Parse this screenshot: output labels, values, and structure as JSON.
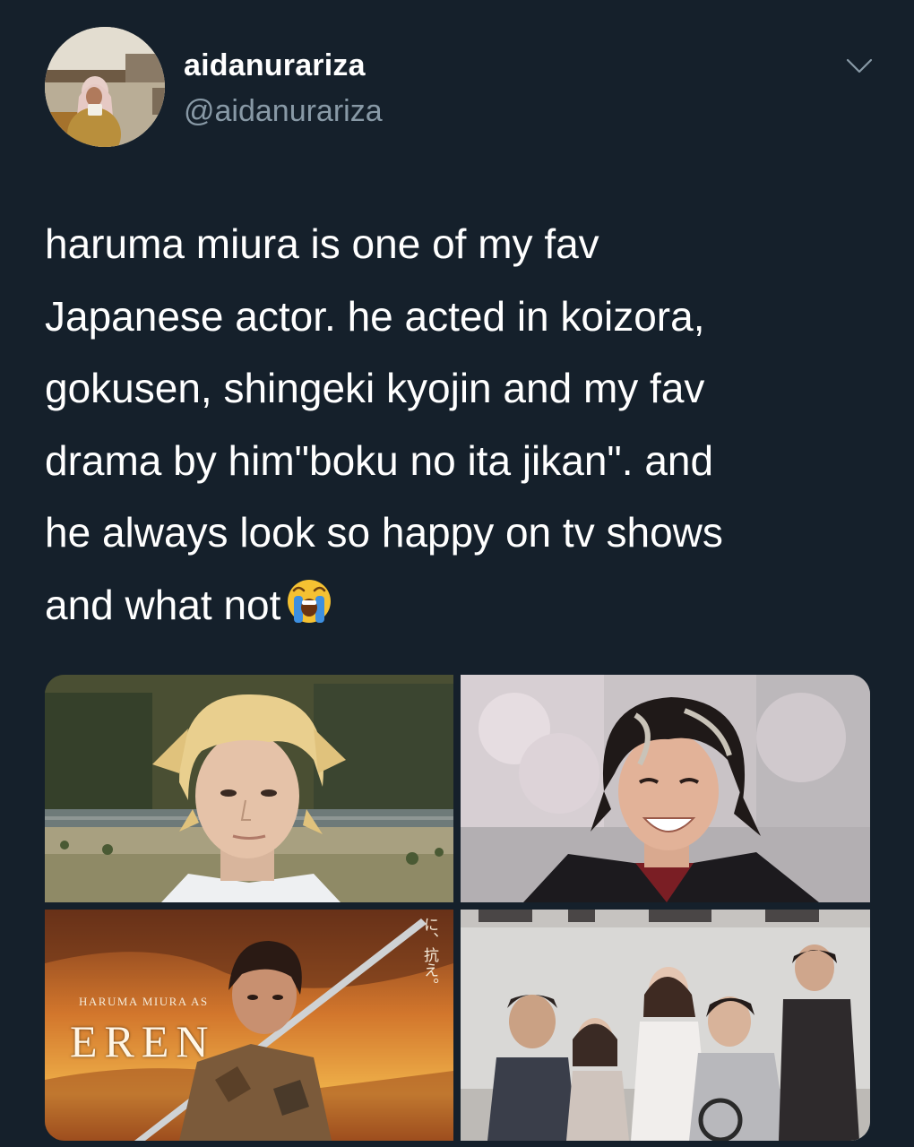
{
  "user": {
    "display_name": "aidanurariza",
    "handle": "@aidanurariza"
  },
  "tweet": {
    "text": "haruma miura is one of my fav\nJapanese actor. he acted in koizora,\ngokusen, shingeki kyojin and my fav\ndrama by him\"boku no ita jikan\". and\nhe always look so happy on tv shows\nand what not",
    "emoji": "loudly-crying-face"
  },
  "media": {
    "photo3": {
      "caption": "HARUMA MIURA AS",
      "title": "EREN",
      "vertical_text": "に、抗え。"
    }
  },
  "icons": {
    "menu": "chevron-down-icon"
  },
  "colors": {
    "background": "#15202b",
    "secondary_text": "#8899a6"
  }
}
